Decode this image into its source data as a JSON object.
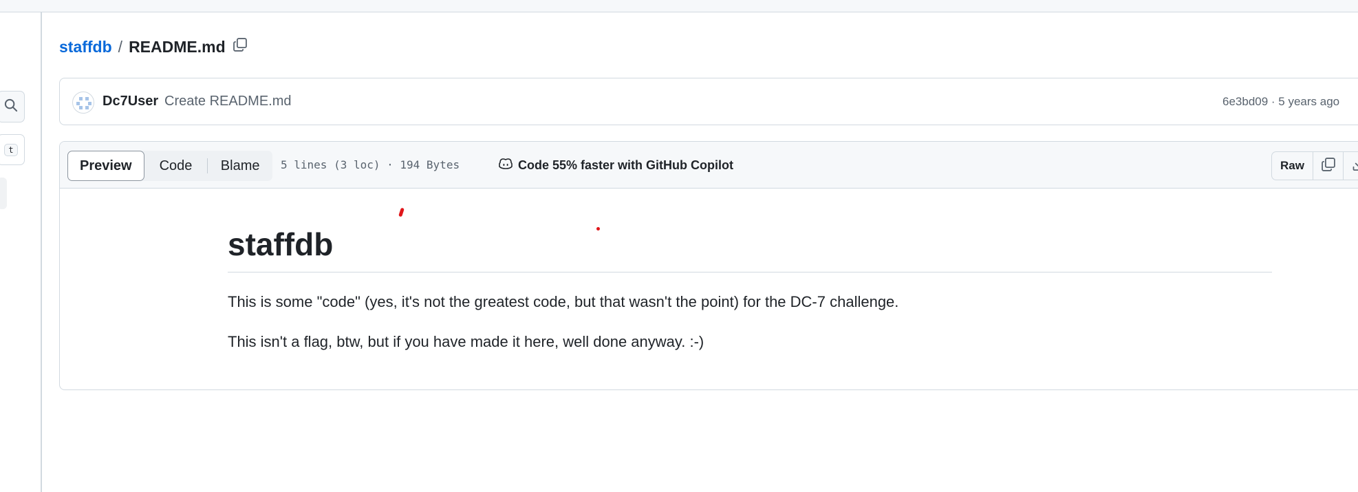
{
  "breadcrumb": {
    "repo": "staffdb",
    "separator": "/",
    "file": "README.md"
  },
  "commit": {
    "author": "Dc7User",
    "message": "Create README.md",
    "meta": "6e3bd09 · 5 years ago"
  },
  "file_header": {
    "tabs": [
      "Preview",
      "Code",
      "Blame"
    ],
    "active_tab": "Preview",
    "lines_info": "5 lines (3 loc) · 194 Bytes",
    "copilot": "Code 55% faster with GitHub Copilot",
    "raw_label": "Raw"
  },
  "rail": {
    "shortcut_key": "t"
  },
  "readme": {
    "title": "staffdb",
    "paragraphs": [
      "This is some \"code\" (yes, it's not the greatest code, but that wasn't the point) for the DC-7 challenge.",
      "This isn't a flag, btw, but if you have made it here, well done anyway. :-)"
    ]
  },
  "colors": {
    "link": "#0969da",
    "text": "#1f2328",
    "muted": "#59636e",
    "border": "#d1d9e0",
    "header_bg": "#f6f8fa",
    "annotation_red": "#e0161a"
  },
  "icons": {
    "search": "search-icon",
    "copy_path": "copy-icon",
    "copilot": "copilot-icon",
    "copy_raw": "copy-icon",
    "download": "download-icon"
  }
}
